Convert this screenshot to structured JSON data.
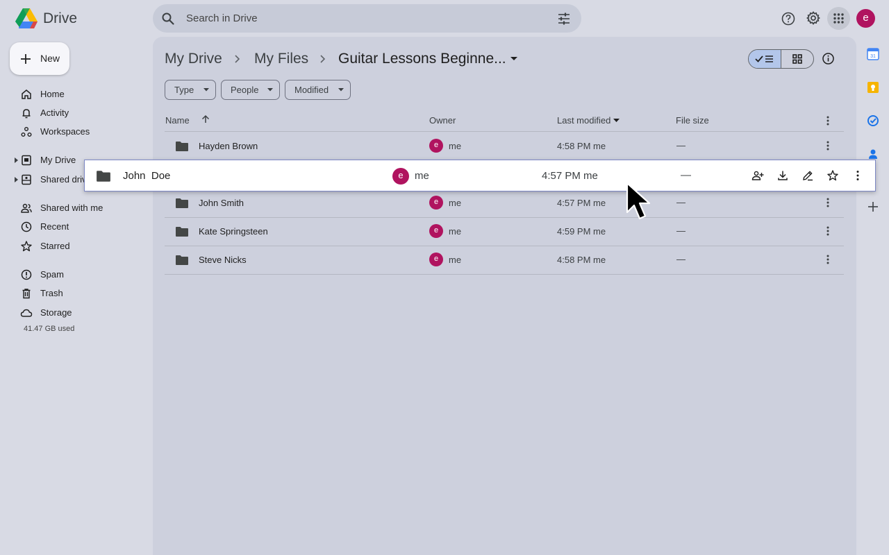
{
  "header": {
    "app_name": "Drive",
    "search_placeholder": "Search in Drive",
    "account_initial": "e"
  },
  "sidebar": {
    "new_label": "New",
    "items": [
      {
        "label": "Home",
        "icon": "home-icon"
      },
      {
        "label": "Activity",
        "icon": "bell-icon"
      },
      {
        "label": "Workspaces",
        "icon": "workspaces-icon"
      },
      {
        "label": "My Drive",
        "icon": "my-drive-icon"
      },
      {
        "label": "Shared drives",
        "icon": "shared-drives-icon"
      },
      {
        "label": "Shared with me",
        "icon": "people-icon"
      },
      {
        "label": "Recent",
        "icon": "clock-icon"
      },
      {
        "label": "Starred",
        "icon": "star-icon"
      },
      {
        "label": "Spam",
        "icon": "spam-icon"
      },
      {
        "label": "Trash",
        "icon": "trash-icon"
      },
      {
        "label": "Storage",
        "icon": "cloud-icon"
      }
    ],
    "storage_used": "41.47 GB used"
  },
  "breadcrumb": {
    "items": [
      "My Drive",
      "My Files"
    ],
    "current": "Guitar Lessons Beginne..."
  },
  "filters": [
    "Type",
    "People",
    "Modified"
  ],
  "table": {
    "headers": {
      "name": "Name",
      "owner": "Owner",
      "modified": "Last modified",
      "size": "File size"
    },
    "rows": [
      {
        "name": "Hayden Brown",
        "owner_initial": "e",
        "owner": "me",
        "modified": "4:58 PM me",
        "size": "—"
      },
      {
        "name": "John Smith",
        "owner_initial": "e",
        "owner": "me",
        "modified": "4:57 PM me",
        "size": "—"
      },
      {
        "name": "Kate Springsteen",
        "owner_initial": "e",
        "owner": "me",
        "modified": "4:59 PM me",
        "size": "—"
      },
      {
        "name": "Steve Nicks",
        "owner_initial": "e",
        "owner": "me",
        "modified": "4:58 PM me",
        "size": "—"
      }
    ]
  },
  "dragged_row": {
    "name": "John  Doe",
    "owner_initial": "e",
    "owner": "me",
    "modified": "4:57 PM me",
    "size": "—"
  },
  "colors": {
    "background": "#d8dae4",
    "panel": "#cdd0dd",
    "accent_avatar": "#b0135f",
    "view_toggle_active": "#b3c6ea"
  }
}
